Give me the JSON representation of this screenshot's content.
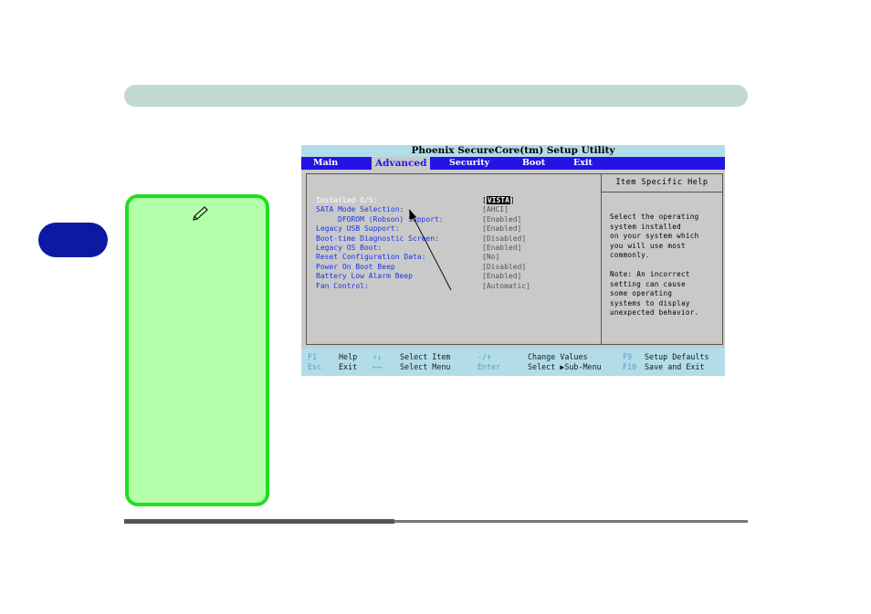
{
  "bios": {
    "title": "Phoenix SecureCore(tm) Setup Utility",
    "menu": [
      "Main",
      "Advanced",
      "Security",
      "Boot",
      "Exit"
    ],
    "options": [
      {
        "label": "Installed O/S:",
        "value": "VISTA",
        "selected": true
      },
      {
        "label": "SATA Mode Selection:",
        "value": "[AHCI]"
      },
      {
        "label": "DFOROM (Robson) Support:",
        "value": "[Enabled]"
      },
      {
        "label": "Legacy USB Support:",
        "value": "[Enabled]"
      },
      {
        "label": "Boot-time Diagnostic Screen:",
        "value": "[Disabled]"
      },
      {
        "label": "Legacy OS Boot:",
        "value": "[Enabled]"
      },
      {
        "label": "Reset Configuration Data:",
        "value": "[No]"
      },
      {
        "label": "Power On Boot Beep",
        "value": "[Disabled]"
      },
      {
        "label": "Battery Low Alarm Beep",
        "value": "[Enabled]"
      },
      {
        "label": "Fan Control:",
        "value": "[Automatic]"
      }
    ],
    "help_header": "Item Specific Help",
    "help_lines": [
      "Select the operating",
      "system installed",
      "on your system which",
      "you will use most",
      "commonly.",
      "",
      "Note: An incorrect",
      "setting can cause",
      "some operating",
      "systems to display",
      "unexpected behavior."
    ],
    "keys": {
      "f1": "F1",
      "help": "Help",
      "updown_icon": "↑↓",
      "select_item": "Select Item",
      "minus_plus": "-/+",
      "change_values": "Change Values",
      "f9": "F9",
      "setup_defaults": "Setup Defaults",
      "esc": "Esc",
      "exit": "Exit",
      "leftright_icon": "←→",
      "select_menu": "Select Menu",
      "enter": "Enter",
      "select_sub_menu": "Select ▶Sub-Menu",
      "f10": "F10",
      "save_exit": "Save and Exit"
    }
  },
  "colors": {
    "header_bar": "#c2d9d3",
    "chapter_tab": "#0b1aa1",
    "note_fill": "#b4ffaa",
    "note_border": "#22dd22",
    "menu_bar": "#2414e4",
    "key_bar": "#b2dce8",
    "option_label": "#1a34e8"
  },
  "icons": {
    "note": "pencil-icon",
    "pointer": "arrow-annotation"
  }
}
